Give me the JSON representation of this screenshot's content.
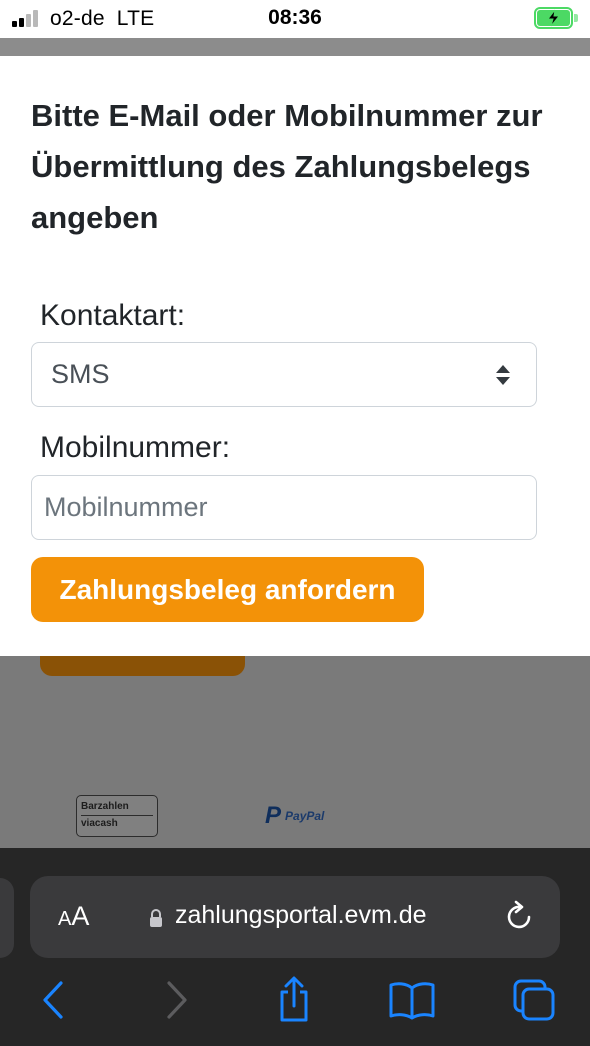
{
  "status_bar": {
    "carrier": "o2-de",
    "network": "LTE",
    "time": "08:36",
    "signal_bars_active": 2,
    "signal_bars_total": 4,
    "battery_state": "charging",
    "battery_color": "#4cd964"
  },
  "modal": {
    "title": "Bitte E-Mail oder Mobilnummer zur Übermittlung des Zahlungsbelegs angeben",
    "contact_type_label": "Kontaktart:",
    "contact_type_value": "SMS",
    "mobile_label": "Mobilnummer:",
    "mobile_placeholder": "Mobilnummer",
    "mobile_value": "",
    "submit_label": "Zahlungsbeleg anfordern",
    "accent_color": "#f39208"
  },
  "background_page": {
    "payment_logos": [
      {
        "name": "barzahlen-viacash-logo",
        "line1": "Barzahlen",
        "line2": "viacash"
      },
      {
        "name": "paypal-logo",
        "text": "PayPal"
      }
    ]
  },
  "browser": {
    "text_size_label_small": "A",
    "text_size_label_big": "A",
    "url": "zahlungsportal.evm.de",
    "icons": [
      "lock-icon",
      "reload-icon",
      "back-icon",
      "forward-icon",
      "share-icon",
      "bookmarks-icon",
      "tabs-icon"
    ]
  }
}
